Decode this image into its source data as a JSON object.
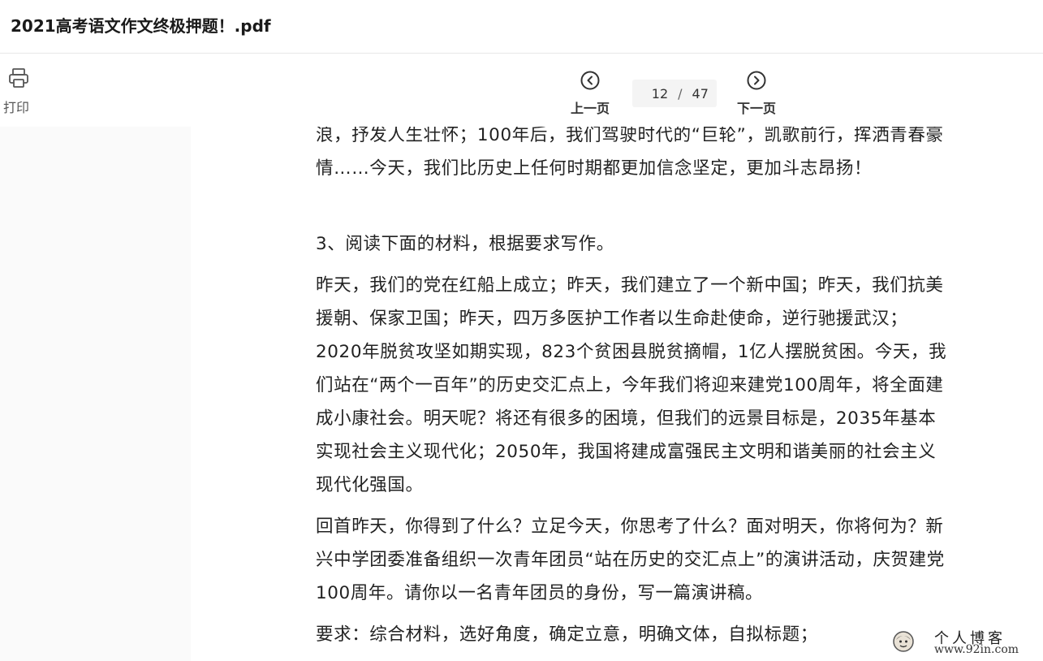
{
  "window": {
    "title": "2021高考语文作文终极押题！.pdf"
  },
  "toolbar": {
    "print": {
      "icon": "printer-icon",
      "label": "打印"
    },
    "prev": {
      "icon": "chevron-left-circle-icon",
      "label": "上一页"
    },
    "next": {
      "icon": "chevron-right-circle-icon",
      "label": "下一页"
    },
    "page": {
      "current": "12",
      "separator": "/",
      "total": "47"
    }
  },
  "document": {
    "lines": [
      "浪，抒发人生壮怀；100年后，我们驾驶时代的“巨轮”，凯歌前行，挥洒青春豪",
      "情……今天，我们比历史上任何时期都更加信念坚定，更加斗志昂扬！"
    ],
    "heading": "3、阅读下面的材料，根据要求写作。",
    "para1": [
      "昨天，我们的党在红船上成立；昨天，我们建立了一个新中国；昨天，我们抗美",
      "援朝、保家卫国；昨天，四万多医护工作者以生命赴使命，逆行驰援武汉；",
      "2020年脱贫攻坚如期实现，823个贫困县脱贫摘帽，1亿人摆脱贫困。今天，我",
      "们站在“两个一百年”的历史交汇点上，今年我们将迎来建党100周年，将全面建",
      "成小康社会。明天呢？将还有很多的困境，但我们的远景目标是，2035年基本",
      "实现社会主义现代化；2050年，我国将建成富强民主文明和谐美丽的社会主义",
      "现代化强国。"
    ],
    "para2": [
      "回首昨天，你得到了什么？立足今天，你思考了什么？面对明天，你将何为？新",
      "兴中学团委准备组织一次青年团员“站在历史的交汇点上”的演讲活动，庆贺建党",
      "100周年。请你以一名青年团员的身份，写一篇演讲稿。"
    ],
    "para3_partial": "要求：综合材料，选好角度，确定立意，明确文体，自拟标题；"
  },
  "watermark": {
    "title": "个人博客",
    "url": "www.92in.com"
  },
  "colors": {
    "background": "#ffffff",
    "side": "#fafafa",
    "text": "#222222",
    "border": "#e8e8e8"
  }
}
